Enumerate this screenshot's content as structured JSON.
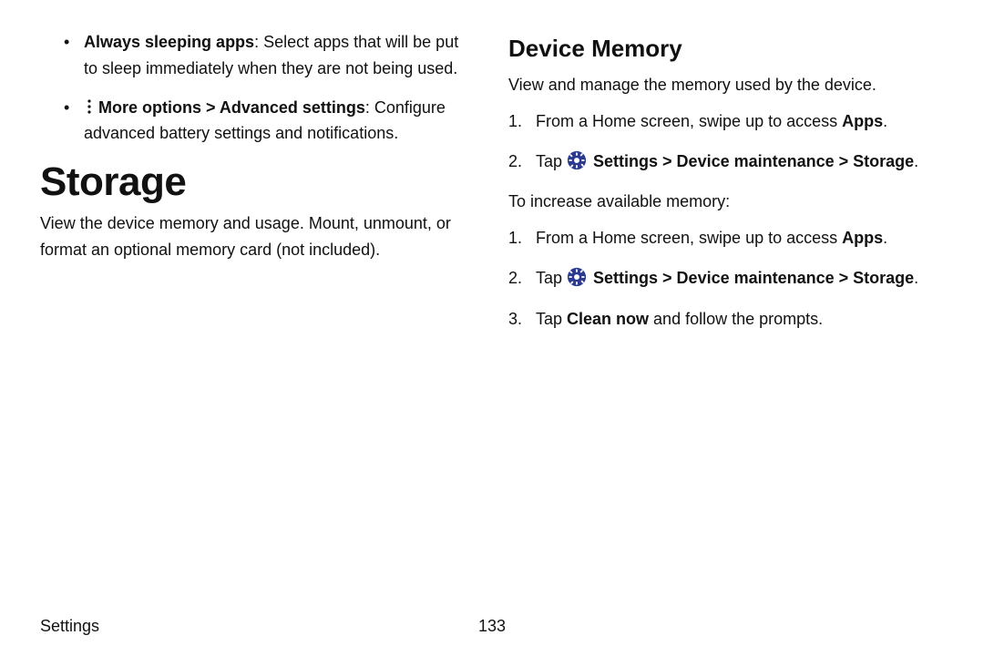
{
  "left": {
    "bullets": [
      {
        "lead_bold": "Always sleeping apps",
        "rest": ": Select apps that will be put to sleep immediately when they are not being used."
      },
      {
        "more_icon": "more-options-icon",
        "lead_bold": "More options > Advanced settings",
        "rest": ": Configure advanced battery settings and notifications."
      }
    ],
    "heading": "Storage",
    "para": "View the device memory and usage. Mount, unmount, or format an optional memory card (not included)."
  },
  "right": {
    "heading": "Device Memory",
    "para": "View and manage the memory used by the device.",
    "steps1": [
      {
        "num": "1.",
        "pre": "From a Home screen, swipe up to access ",
        "bold1": "Apps",
        "post": "."
      },
      {
        "num": "2.",
        "pre": "Tap ",
        "icon": "settings-icon",
        "bold1": " Settings > Device maintenance > Storage",
        "post": "."
      }
    ],
    "mid_para": "To increase available memory:",
    "steps2": [
      {
        "num": "1.",
        "pre": "From a Home screen, swipe up to access ",
        "bold1": "Apps",
        "post": "."
      },
      {
        "num": "2.",
        "pre": "Tap ",
        "icon": "settings-icon",
        "bold1": " Settings > Device maintenance > Storage",
        "post": "."
      },
      {
        "num": "3.",
        "pre": "Tap ",
        "bold1": "Clean now",
        "post": " and follow the prompts."
      }
    ]
  },
  "footer": {
    "section": "Settings",
    "pagenum": "133"
  }
}
